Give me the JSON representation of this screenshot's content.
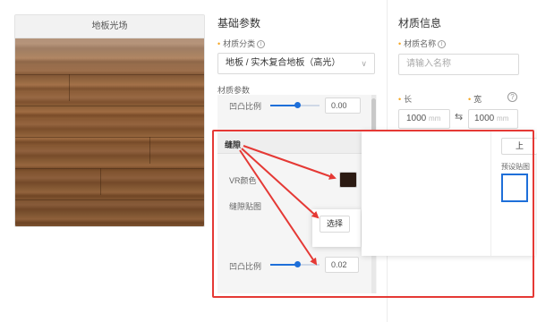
{
  "preview": {
    "title": "地板光场"
  },
  "basic": {
    "title": "基础参数",
    "category_label": "材质分类",
    "category_value": "地板 / 实木复合地板（高光）",
    "params_label": "材质参数",
    "bump_label": "凹凸比例",
    "bump_value": "0.00",
    "bump_level": 0.55
  },
  "seam": {
    "title": "缝隙",
    "vr_color_label": "VR颜色",
    "vr_color": "#2b1a12",
    "seam_map_label": "缝隙贴图",
    "select_button": "选择",
    "bump_label": "凹凸比例",
    "bump_value": "0.02",
    "bump_level": 0.55
  },
  "material_info": {
    "title": "材质信息",
    "name_label": "材质名称",
    "name_placeholder": "请输入名称",
    "length_label": "长",
    "width_label": "宽",
    "length_value": "1000",
    "width_value": "1000",
    "unit": "mm",
    "swap_symbol": "⇆",
    "help_symbol": "?",
    "upload_button": "上",
    "preset_map_label": "预设贴图"
  },
  "colors": {
    "accent": "#1e6fd9",
    "required": "#f5a623",
    "annotation": "#e53935"
  }
}
